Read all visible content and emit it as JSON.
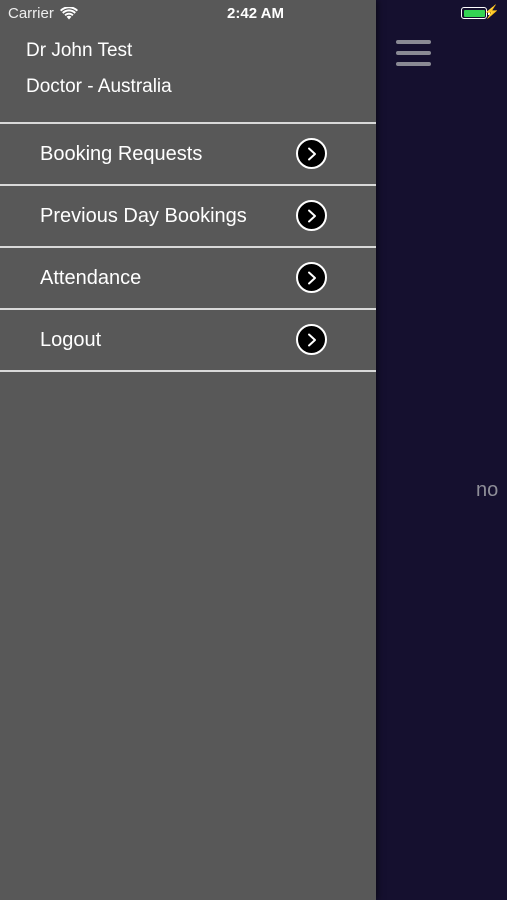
{
  "status_bar": {
    "carrier": "Carrier",
    "time": "2:42 AM",
    "battery_color": "#33d453"
  },
  "drawer": {
    "background": "#585858",
    "profile": {
      "name": "Dr John Test",
      "role": "Doctor - Australia"
    },
    "menu": [
      {
        "label": "Booking Requests",
        "icon": "chevron-right-circle-icon"
      },
      {
        "label": "Previous Day Bookings",
        "icon": "chevron-right-circle-icon"
      },
      {
        "label": "Attendance",
        "icon": "chevron-right-circle-icon"
      },
      {
        "label": "Logout",
        "icon": "chevron-right-circle-icon"
      }
    ]
  },
  "main": {
    "background": "#15102f",
    "menu_icon": "hamburger-icon",
    "content_text": "no"
  }
}
